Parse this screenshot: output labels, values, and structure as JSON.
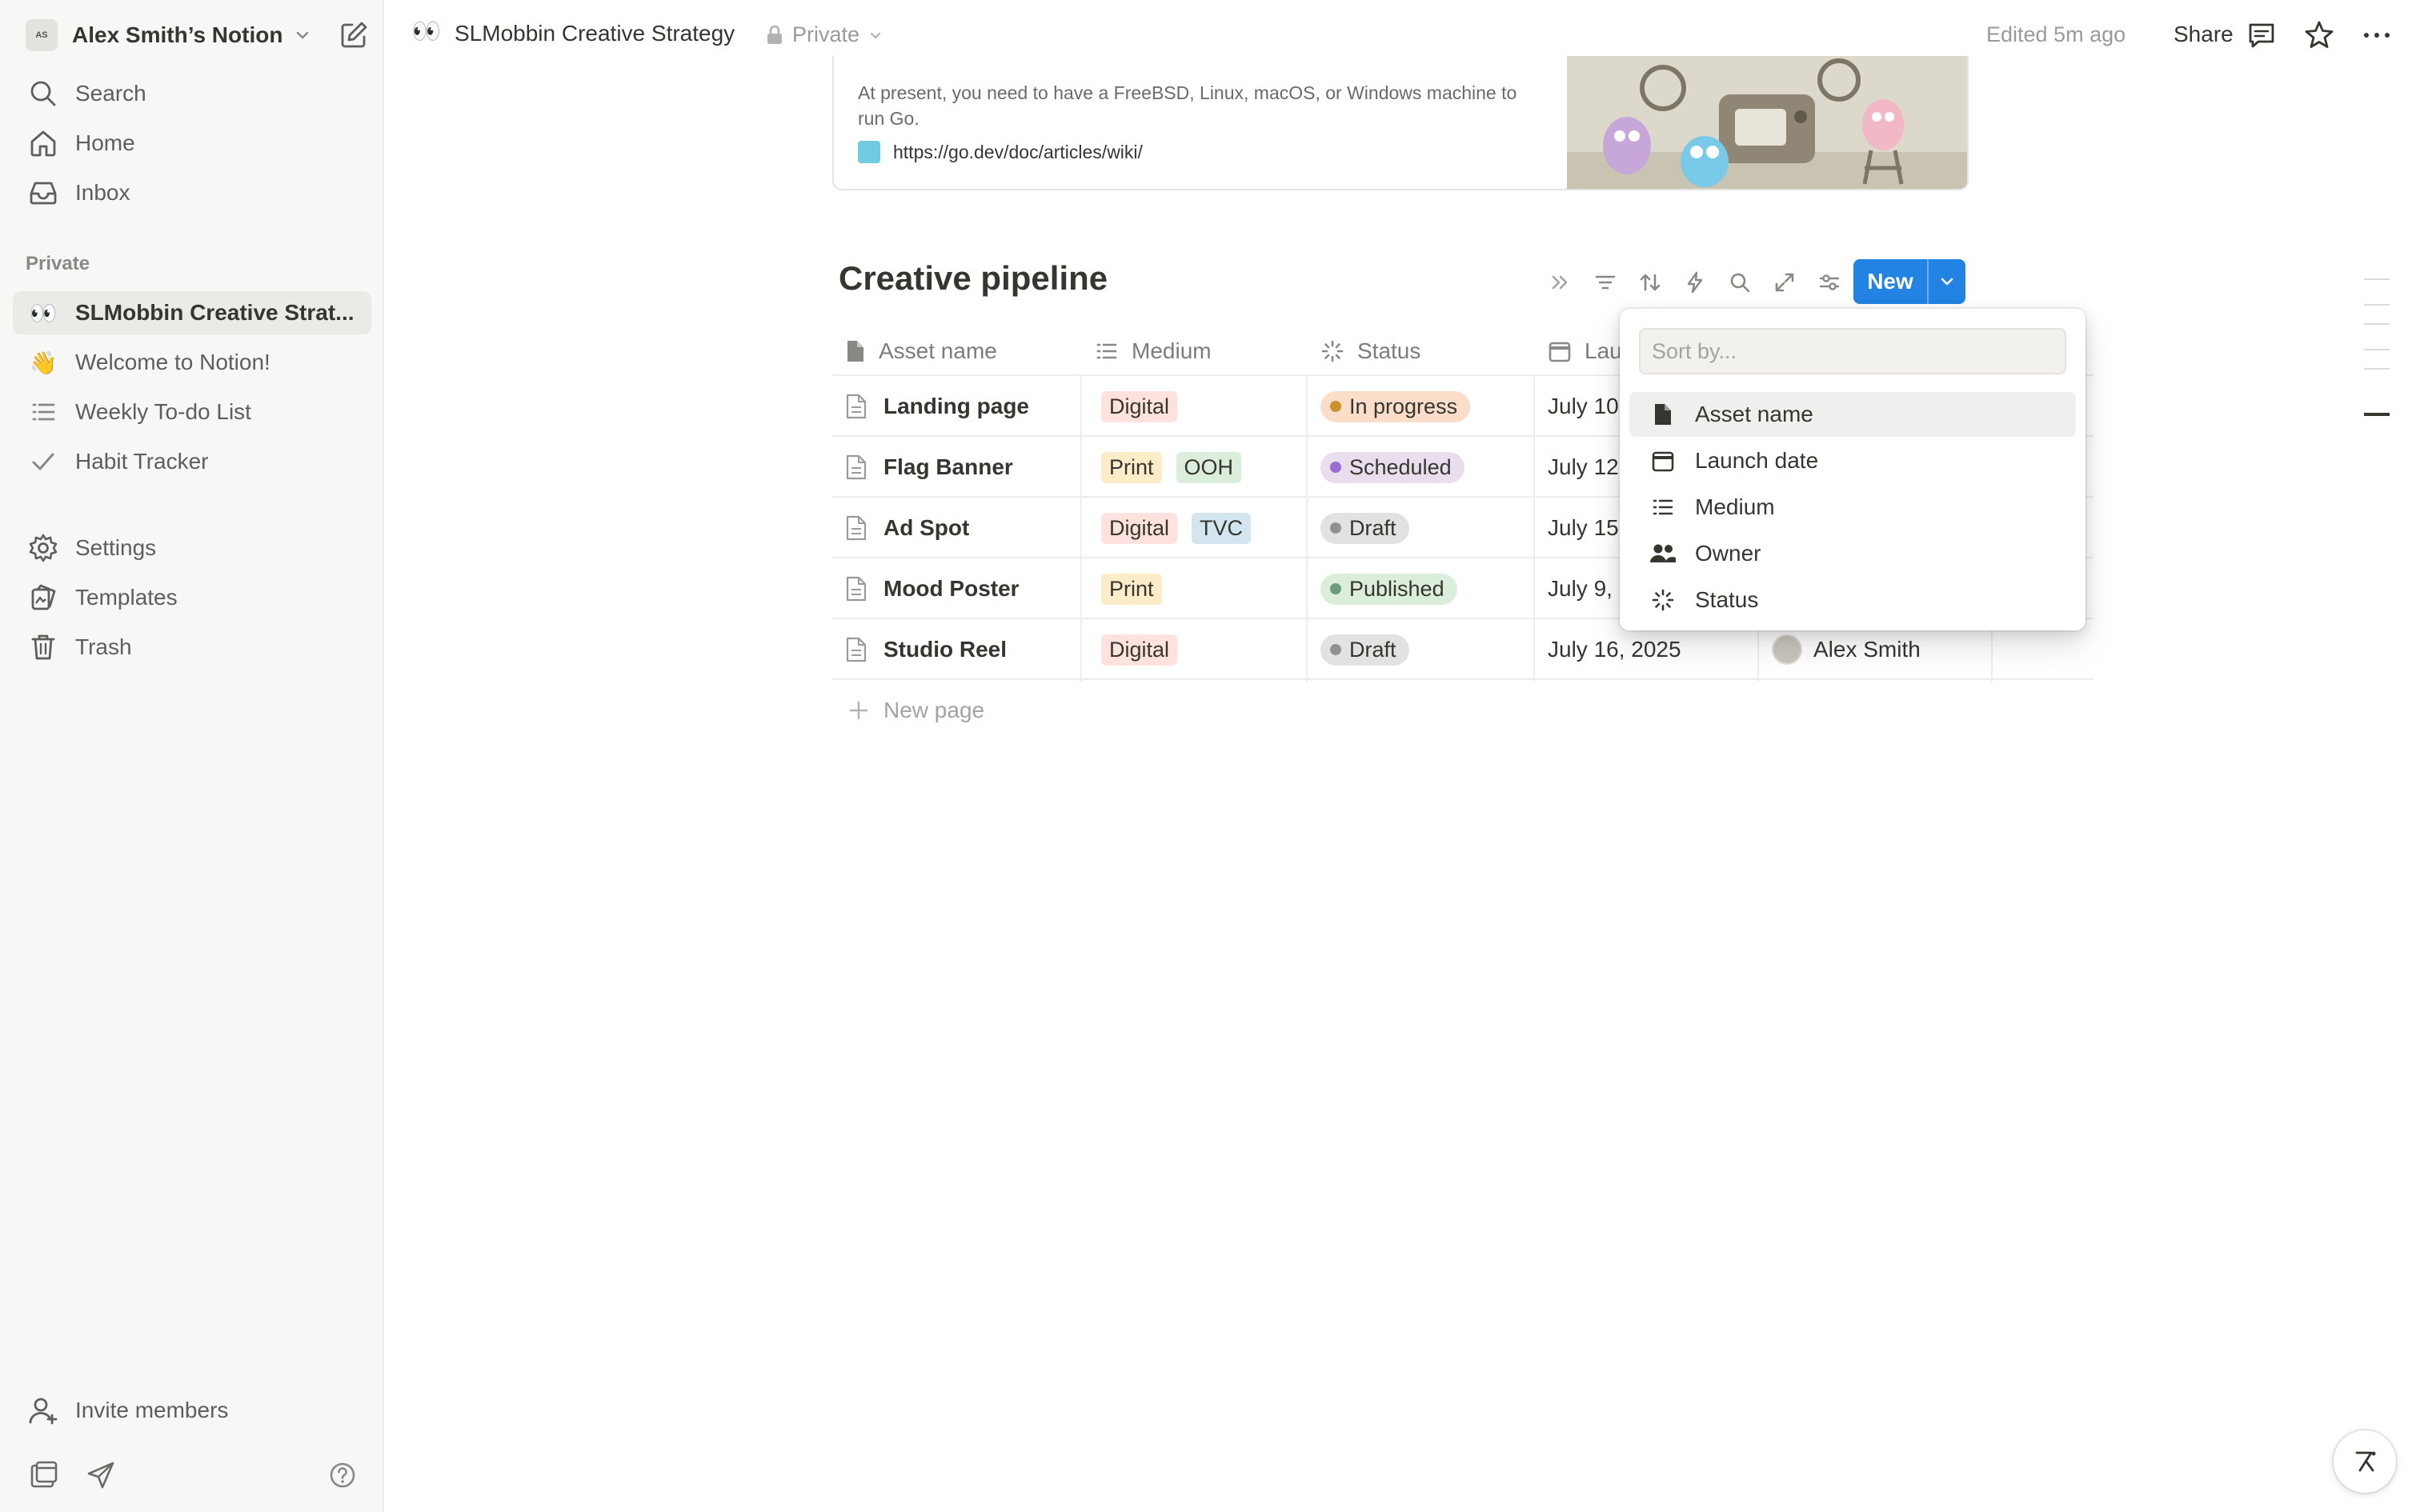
{
  "workspace": {
    "name": "Alex Smith’s Notion",
    "logo_text": "AS"
  },
  "sidebar": {
    "top_items": [
      {
        "label": "Search",
        "icon": "search-icon"
      },
      {
        "label": "Home",
        "icon": "home-icon"
      },
      {
        "label": "Inbox",
        "icon": "inbox-icon"
      }
    ],
    "section_label": "Private",
    "pages": [
      {
        "emoji": "👀",
        "label": "SLMobbin Creative Strat...",
        "active": true
      },
      {
        "emoji": "👋",
        "label": "Welcome to Notion!"
      },
      {
        "emoji": "",
        "label": "Weekly To-do List",
        "icon": "list-icon"
      },
      {
        "emoji": "",
        "label": "Habit Tracker",
        "icon": "check-icon"
      }
    ],
    "utility_items": [
      {
        "label": "Settings",
        "icon": "gear-icon"
      },
      {
        "label": "Templates",
        "icon": "templates-icon"
      },
      {
        "label": "Trash",
        "icon": "trash-icon"
      }
    ],
    "invite_label": "Invite members"
  },
  "topbar": {
    "page_emoji": "👀",
    "page_title": "SLMobbin Creative Strategy",
    "privacy": "Private",
    "edited": "Edited 5m ago",
    "share_label": "Share"
  },
  "preview": {
    "description": "At present, you need to have a FreeBSD, Linux, macOS, or Windows machine to run Go.",
    "url": "https://go.dev/doc/articles/wiki/"
  },
  "database": {
    "title": "Creative pipeline",
    "new_label": "New",
    "columns": [
      {
        "label": "Asset name",
        "icon": "page-icon"
      },
      {
        "label": "Medium",
        "icon": "list-icon"
      },
      {
        "label": "Status",
        "icon": "status-icon"
      },
      {
        "label": "Lau",
        "icon": "calendar-icon"
      }
    ],
    "rows": [
      {
        "name": "Landing page",
        "medium": [
          "Digital"
        ],
        "status": "In progress",
        "date": "July 10",
        "owner": ""
      },
      {
        "name": "Flag Banner",
        "medium": [
          "Print",
          "OOH"
        ],
        "status": "Scheduled",
        "date": "July 12",
        "owner": ""
      },
      {
        "name": "Ad Spot",
        "medium": [
          "Digital",
          "TVC"
        ],
        "status": "Draft",
        "date": "July 15",
        "owner": ""
      },
      {
        "name": "Mood Poster",
        "medium": [
          "Print"
        ],
        "status": "Published",
        "date": "July 9,",
        "owner": ""
      },
      {
        "name": "Studio Reel",
        "medium": [
          "Digital"
        ],
        "status": "Draft",
        "date": "July 16, 2025",
        "owner": "Alex Smith"
      }
    ],
    "new_page_label": "New page"
  },
  "sort_popup": {
    "placeholder": "Sort by...",
    "options": [
      {
        "label": "Asset name",
        "icon": "page-icon"
      },
      {
        "label": "Launch date",
        "icon": "calendar-icon"
      },
      {
        "label": "Medium",
        "icon": "list-icon"
      },
      {
        "label": "Owner",
        "icon": "people-icon"
      },
      {
        "label": "Status",
        "icon": "status-icon"
      }
    ]
  },
  "colors": {
    "accent": "#2383e2",
    "tag_digital": "#ffe2dd",
    "tag_print": "#fdecc8",
    "tag_ooh": "#dbeddb",
    "tag_tvc": "#d3e5ef",
    "status_in_progress_bg": "#fadec9",
    "status_in_progress_dot": "#cb912f",
    "status_scheduled_bg": "#e8deee",
    "status_scheduled_dot": "#9a6dd7",
    "status_draft_bg": "#e3e2e0",
    "status_draft_dot": "#91918e",
    "status_published_bg": "#dbeddb",
    "status_published_dot": "#6c9b7d"
  }
}
